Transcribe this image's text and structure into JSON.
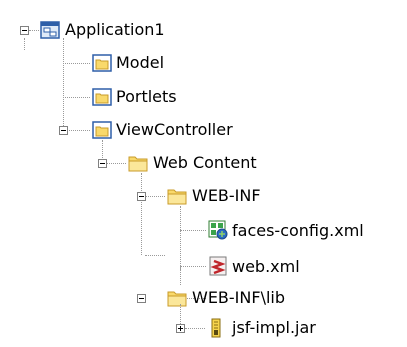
{
  "tree": {
    "application": {
      "label": "Application1",
      "expanded": true,
      "icon": "application-icon"
    },
    "model": {
      "label": "Model",
      "icon": "project-folder-icon"
    },
    "portlets": {
      "label": "Portlets",
      "icon": "project-folder-icon"
    },
    "viewcontroller": {
      "label": "ViewController",
      "expanded": true,
      "icon": "project-folder-icon"
    },
    "web_content": {
      "label": "Web Content",
      "expanded": true,
      "icon": "folder-icon"
    },
    "web_inf": {
      "label": "WEB-INF",
      "expanded": true,
      "icon": "folder-icon"
    },
    "faces_config": {
      "label": "faces-config.xml",
      "icon": "faces-config-icon"
    },
    "web_xml": {
      "label": "web.xml",
      "icon": "xml-file-icon"
    },
    "web_inf_lib": {
      "label": "WEB-INF\\lib",
      "expanded": true,
      "icon": "folder-icon"
    },
    "jsf_impl": {
      "label": "jsf-impl.jar",
      "expanded": false,
      "icon": "jar-icon"
    }
  },
  "colors": {
    "folder_fill": "#f9d96b",
    "folder_edge": "#c89b2a",
    "project_frame": "#2e5fa8",
    "connector": "#9a9a9a"
  }
}
